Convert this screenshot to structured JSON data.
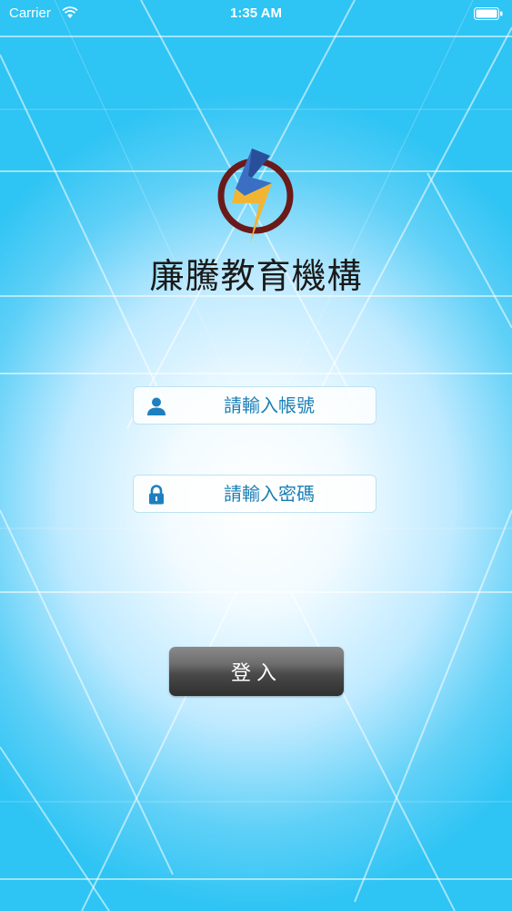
{
  "status_bar": {
    "carrier": "Carrier",
    "time": "1:35 AM"
  },
  "app": {
    "title": "廉騰教育機構",
    "logo": "lightning-bolt-circle-logo"
  },
  "login_form": {
    "username": {
      "placeholder": "請輸入帳號",
      "value": "",
      "icon": "user-icon"
    },
    "password": {
      "placeholder": "請輸入密碼",
      "value": "",
      "icon": "lock-icon"
    },
    "submit_label": "登入"
  },
  "colors": {
    "background": "#2ec4f4",
    "field_text": "#1b7fb5",
    "icon": "#1e7fc0",
    "button_top": "#8a8a8a",
    "button_bottom": "#2f2f2f",
    "logo_ring": "#6b1a1a",
    "logo_blue": "#3a6fc4",
    "logo_yellow": "#f2b533"
  }
}
